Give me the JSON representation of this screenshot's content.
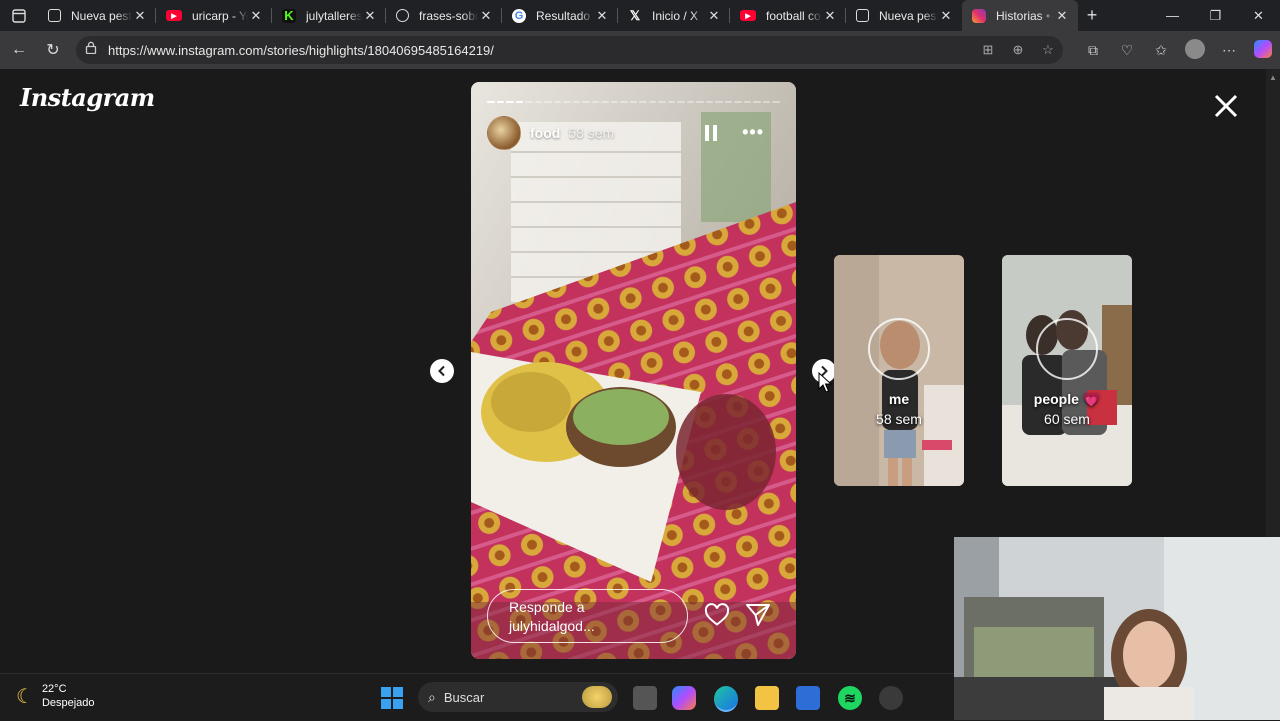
{
  "browser": {
    "tabs": [
      {
        "title": "Nueva pestaña",
        "icon": "page-icon",
        "color": "#e8e8e8"
      },
      {
        "title": "uricarp - YouTube",
        "icon": "youtube-icon",
        "color": "#ff0033"
      },
      {
        "title": "julytalleresS",
        "icon": "kick-icon",
        "color": "#53fc18"
      },
      {
        "title": "frases-sobre",
        "icon": "globe-icon",
        "color": "#e8e8e8"
      },
      {
        "title": "Resultado de",
        "icon": "google-icon",
        "color": "#4285f4"
      },
      {
        "title": "Inicio / X",
        "icon": "x-icon",
        "color": "#e8e8e8"
      },
      {
        "title": "football com",
        "icon": "youtube-icon",
        "color": "#ff0033"
      },
      {
        "title": "Nueva pestaña",
        "icon": "page-icon",
        "color": "#e8e8e8"
      },
      {
        "title": "Historias • In",
        "icon": "instagram-icon",
        "color": "#e1306c"
      }
    ],
    "url": "https://www.instagram.com/stories/highlights/18040695485164219/"
  },
  "instagram": {
    "logo": "Instagram",
    "story": {
      "username": "food",
      "time": "58 sem",
      "segments_total": 31,
      "segments_done": 4,
      "reply_placeholder_line1": "Responde a",
      "reply_placeholder_line2": "julyhidalgod..."
    },
    "next_highlights": [
      {
        "name": "me",
        "time": "58 sem"
      },
      {
        "name": "people 💗",
        "time": "60 sem"
      }
    ]
  },
  "taskbar": {
    "temperature": "22°C",
    "condition": "Despejado",
    "search_label": "Buscar"
  },
  "colors": {
    "background": "#1a1a1a",
    "browser_chrome": "#3a3a3c",
    "tab_strip": "#202124"
  }
}
